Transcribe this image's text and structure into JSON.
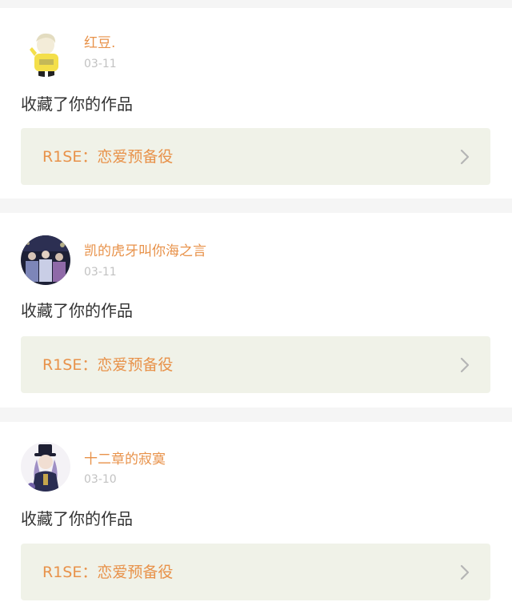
{
  "colors": {
    "accent": "#e8924a",
    "link_background": "#f0f2e8",
    "page_background": "#f5f5f5",
    "card_background": "#ffffff",
    "text_dark": "#333333",
    "text_muted": "#c2c2c2",
    "chevron": "#b5b5b5"
  },
  "notifications": [
    {
      "username": "红豆.",
      "date": "03-11",
      "action": "收藏了你的作品",
      "work_title": "R1SE：恋爱预备役",
      "avatar_icon": "yellow-sweater-cartoon-avatar",
      "chevron_icon": "chevron-right-icon"
    },
    {
      "username": "凯的虎牙叫你海之言",
      "date": "03-11",
      "action": "收藏了你的作品",
      "work_title": "R1SE：恋爱预备役",
      "avatar_icon": "group-photo-avatar",
      "chevron_icon": "chevron-right-icon"
    },
    {
      "username": "十二章的寂寞",
      "date": "03-10",
      "action": "收藏了你的作品",
      "work_title": "R1SE：恋爱预备役",
      "avatar_icon": "top-hat-anime-character-avatar",
      "chevron_icon": "chevron-right-icon"
    }
  ]
}
